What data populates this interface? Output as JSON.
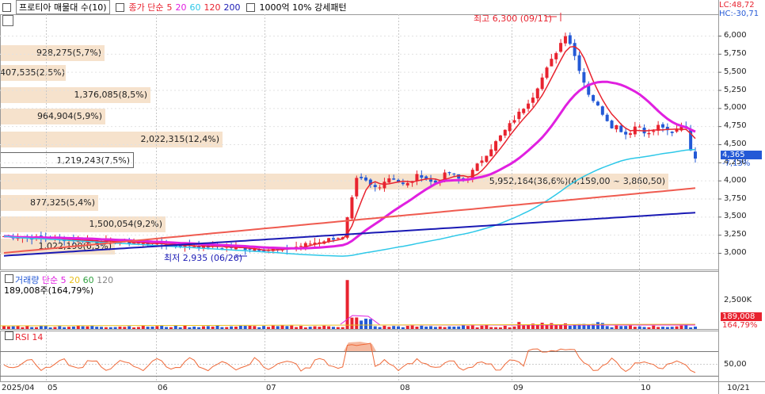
{
  "header": {
    "stock_name": "프로티아 매물대 수(10)",
    "ma_label": "종가 단순",
    "ma_periods": [
      "5",
      "20",
      "60",
      "120",
      "200"
    ],
    "filter_label": "1000억 10% 강세패턴"
  },
  "top_right": {
    "lc": "LC:48,72",
    "hc": "HC:-30,71"
  },
  "volume_profile": [
    {
      "label": "928,275(5,7%)",
      "fill": 0.145
    },
    {
      "label": "407,535(2,5%)",
      "fill": 0.092
    },
    {
      "label": "1,376,085(8,5%)",
      "fill": 0.21
    },
    {
      "label": "964,904(5,9%)",
      "fill": 0.147
    },
    {
      "label": "2,022,315(12,4%)",
      "fill": 0.31
    },
    {
      "label": "1,219,243(7,5%)",
      "fill": 0.186,
      "selected": true
    },
    {
      "label": "5,952,164(36,6%)(4,159,00 ~ 3,860,50)",
      "fill": 0.93
    },
    {
      "label": "877,325(5,4%)",
      "fill": 0.137
    },
    {
      "label": "1,500,054(9,2%)",
      "fill": 0.23
    },
    {
      "label": "1,022,190(6,3%)",
      "fill": 0.16
    }
  ],
  "annotations": {
    "high": "최고 6,300 (09/11)",
    "low": "최저 2,935 (06/26)"
  },
  "price_axis": {
    "ticks": [
      "6,000",
      "5,750",
      "5,500",
      "5,250",
      "5,000",
      "4,750",
      "4,500",
      "4,250",
      "4,000",
      "3,750",
      "3,500",
      "3,250",
      "3,000"
    ],
    "current": "4,365",
    "change": "-7,13%"
  },
  "volume_panel": {
    "label": "거래량",
    "ma_label": "단순",
    "ma_periods": [
      "5",
      "20",
      "60",
      "120"
    ],
    "info": "189,008주(164,79%)",
    "axis_tick": "2,500K",
    "current": "189,008",
    "change": "164,79%"
  },
  "rsi_panel": {
    "label": "RSI 14",
    "axis_tick": "50,00"
  },
  "x_axis": [
    "2025/04",
    "05",
    "06",
    "07",
    "08",
    "09",
    "10",
    "10/21"
  ],
  "colors": {
    "up": "#e8232f",
    "down": "#2459d6",
    "ma5": "#e8232f",
    "ma20": "#e020e0",
    "ma60": "#2ec8e8",
    "ma120": "#ef5b50",
    "ma200": "#1a1ab4",
    "profile": "#f6e2cc"
  }
}
